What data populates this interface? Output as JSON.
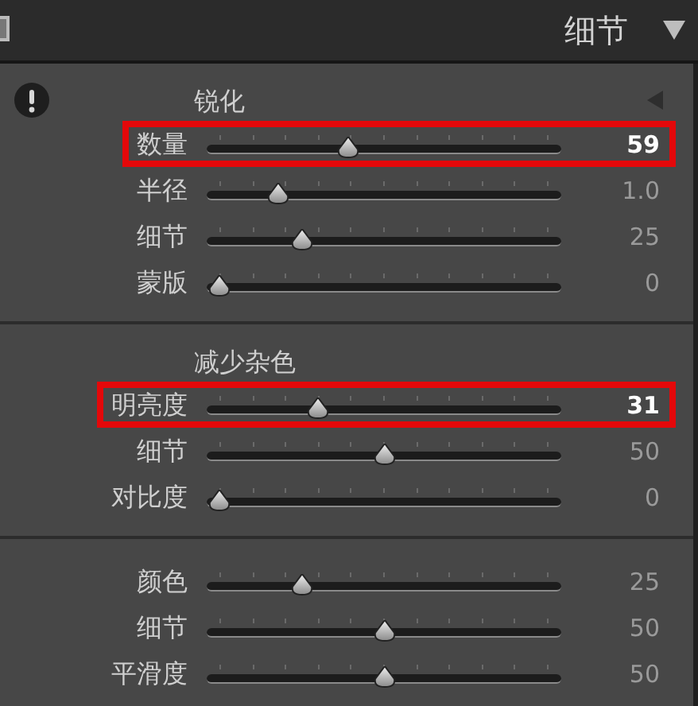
{
  "header": {
    "title": "细节"
  },
  "sections": [
    {
      "title": "锐化",
      "warning": true,
      "collapse": true,
      "rows": [
        {
          "label": "数量",
          "level": 0.39,
          "value": "59",
          "highlighted": true
        },
        {
          "label": "半径",
          "level": 0.18,
          "value": "1.0",
          "highlighted": false
        },
        {
          "label": "细节",
          "level": 0.25,
          "value": "25",
          "highlighted": false
        },
        {
          "label": "蒙版",
          "level": 0,
          "value": "0",
          "highlighted": false
        }
      ]
    },
    {
      "title": "减少杂色",
      "rows": [
        {
          "label": "明亮度",
          "level": 0.3,
          "value": "31",
          "highlighted": true
        },
        {
          "label": "细节",
          "level": 0.5,
          "value": "50",
          "highlighted": false
        },
        {
          "label": "对比度",
          "level": 0,
          "value": "0",
          "highlighted": false
        }
      ]
    },
    {
      "rows": [
        {
          "label": "颜色",
          "level": 0.25,
          "value": "25",
          "highlighted": false
        },
        {
          "label": "细节",
          "level": 0.5,
          "value": "50",
          "highlighted": false
        },
        {
          "label": "平滑度",
          "level": 0.5,
          "value": "50",
          "highlighted": false
        }
      ]
    }
  ]
}
